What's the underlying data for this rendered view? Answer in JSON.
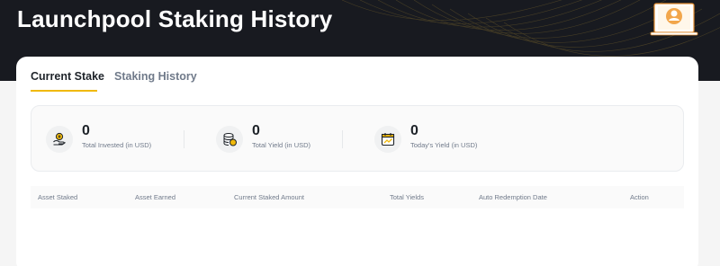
{
  "page": {
    "title": "Launchpool Staking History"
  },
  "tabs": [
    {
      "label": "Current Stake",
      "active": true
    },
    {
      "label": "Staking History",
      "active": false
    }
  ],
  "stats": [
    {
      "value": "0",
      "label": "Total Invested (in USD)",
      "icon": "hand-coin-icon"
    },
    {
      "value": "0",
      "label": "Total Yield (in USD)",
      "icon": "coin-stack-icon"
    },
    {
      "value": "0",
      "label": "Today's Yield (in USD)",
      "icon": "calendar-chart-icon"
    }
  ],
  "table": {
    "columns": [
      "Asset Staked",
      "Asset Earned",
      "Current Staked Amount",
      "Total Yields",
      "Auto Redemption Date",
      "Action"
    ],
    "rows": []
  },
  "colors": {
    "hero_bg": "#181a20",
    "accent": "#f0b90b",
    "text_primary": "#1e2329",
    "text_secondary": "#707a8a"
  }
}
